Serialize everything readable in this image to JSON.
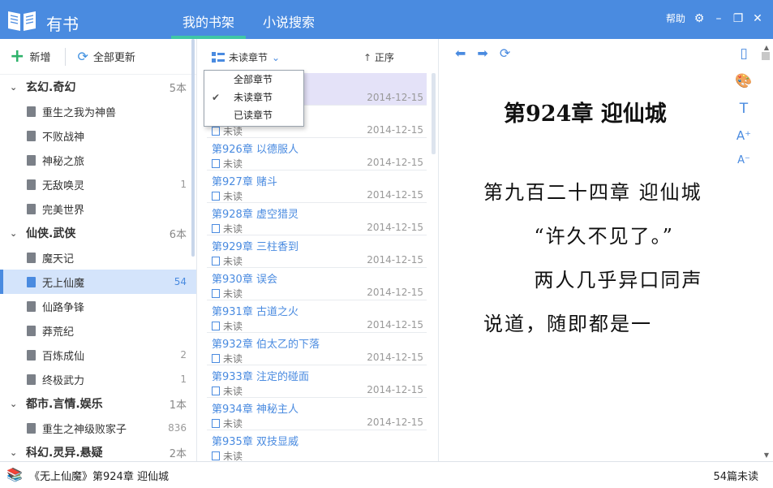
{
  "header": {
    "app_title": "有书",
    "tabs": [
      {
        "label": "我的书架",
        "active": true
      },
      {
        "label": "小说搜索",
        "active": false
      }
    ],
    "help_label": "帮助"
  },
  "sidebar": {
    "add_label": "新增",
    "update_all_label": "全部更新",
    "categories": [
      {
        "name": "玄幻.奇幻",
        "count": "5本",
        "books": [
          {
            "title": "重生之我为神兽",
            "count": ""
          },
          {
            "title": "不败战神",
            "count": ""
          },
          {
            "title": "神秘之旅",
            "count": ""
          },
          {
            "title": "无敌唤灵",
            "count": "1"
          },
          {
            "title": "完美世界",
            "count": ""
          }
        ]
      },
      {
        "name": "仙侠.武侠",
        "count": "6本",
        "books": [
          {
            "title": "魔天记",
            "count": ""
          },
          {
            "title": "无上仙魔",
            "count": "54",
            "selected": true
          },
          {
            "title": "仙路争锋",
            "count": ""
          },
          {
            "title": "莽荒纪",
            "count": ""
          },
          {
            "title": "百炼成仙",
            "count": "2"
          },
          {
            "title": "终极武力",
            "count": "1"
          }
        ]
      },
      {
        "name": "都市.言情.娱乐",
        "count": "1本",
        "books": [
          {
            "title": "重生之神级败家子",
            "count": "836"
          }
        ]
      },
      {
        "name": "科幻.灵异.悬疑",
        "count": "2本",
        "books": []
      }
    ]
  },
  "chapter_list": {
    "filter_label": "未读章节",
    "sort_label": "正序",
    "dropdown": [
      {
        "label": "全部章节",
        "checked": false
      },
      {
        "label": "未读章节",
        "checked": true
      },
      {
        "label": "已读章节",
        "checked": false
      }
    ],
    "rows": [
      {
        "title": "",
        "status": "",
        "date": "2014-12-15",
        "highlight": true
      },
      {
        "title": "",
        "status": "未读",
        "date": "2014-12-15"
      },
      {
        "title": "第926章 以德服人",
        "status": "未读",
        "date": "2014-12-15"
      },
      {
        "title": "第927章 赌斗",
        "status": "未读",
        "date": "2014-12-15"
      },
      {
        "title": "第928章 虚空猎灵",
        "status": "未读",
        "date": "2014-12-15"
      },
      {
        "title": "第929章 三柱香到",
        "status": "未读",
        "date": "2014-12-15"
      },
      {
        "title": "第930章 误会",
        "status": "未读",
        "date": "2014-12-15"
      },
      {
        "title": "第931章 古道之火",
        "status": "未读",
        "date": "2014-12-15"
      },
      {
        "title": "第932章 伯太乙的下落",
        "status": "未读",
        "date": "2014-12-15"
      },
      {
        "title": "第933章 注定的碰面",
        "status": "未读",
        "date": "2014-12-15"
      },
      {
        "title": "第934章 神秘主人",
        "status": "未读",
        "date": "2014-12-15"
      },
      {
        "title": "第935章 双技显威",
        "status": "未读",
        "date": ""
      }
    ]
  },
  "reader": {
    "chapter_title": "第924章  迎仙城",
    "paragraphs": [
      "第九百二十四章 迎仙城",
      "“许久不见了。”",
      "两人几乎异口同声说道，随即都是一"
    ]
  },
  "status_bar": {
    "current": "《无上仙魔》第924章 迎仙城",
    "unread": "54篇未读"
  }
}
